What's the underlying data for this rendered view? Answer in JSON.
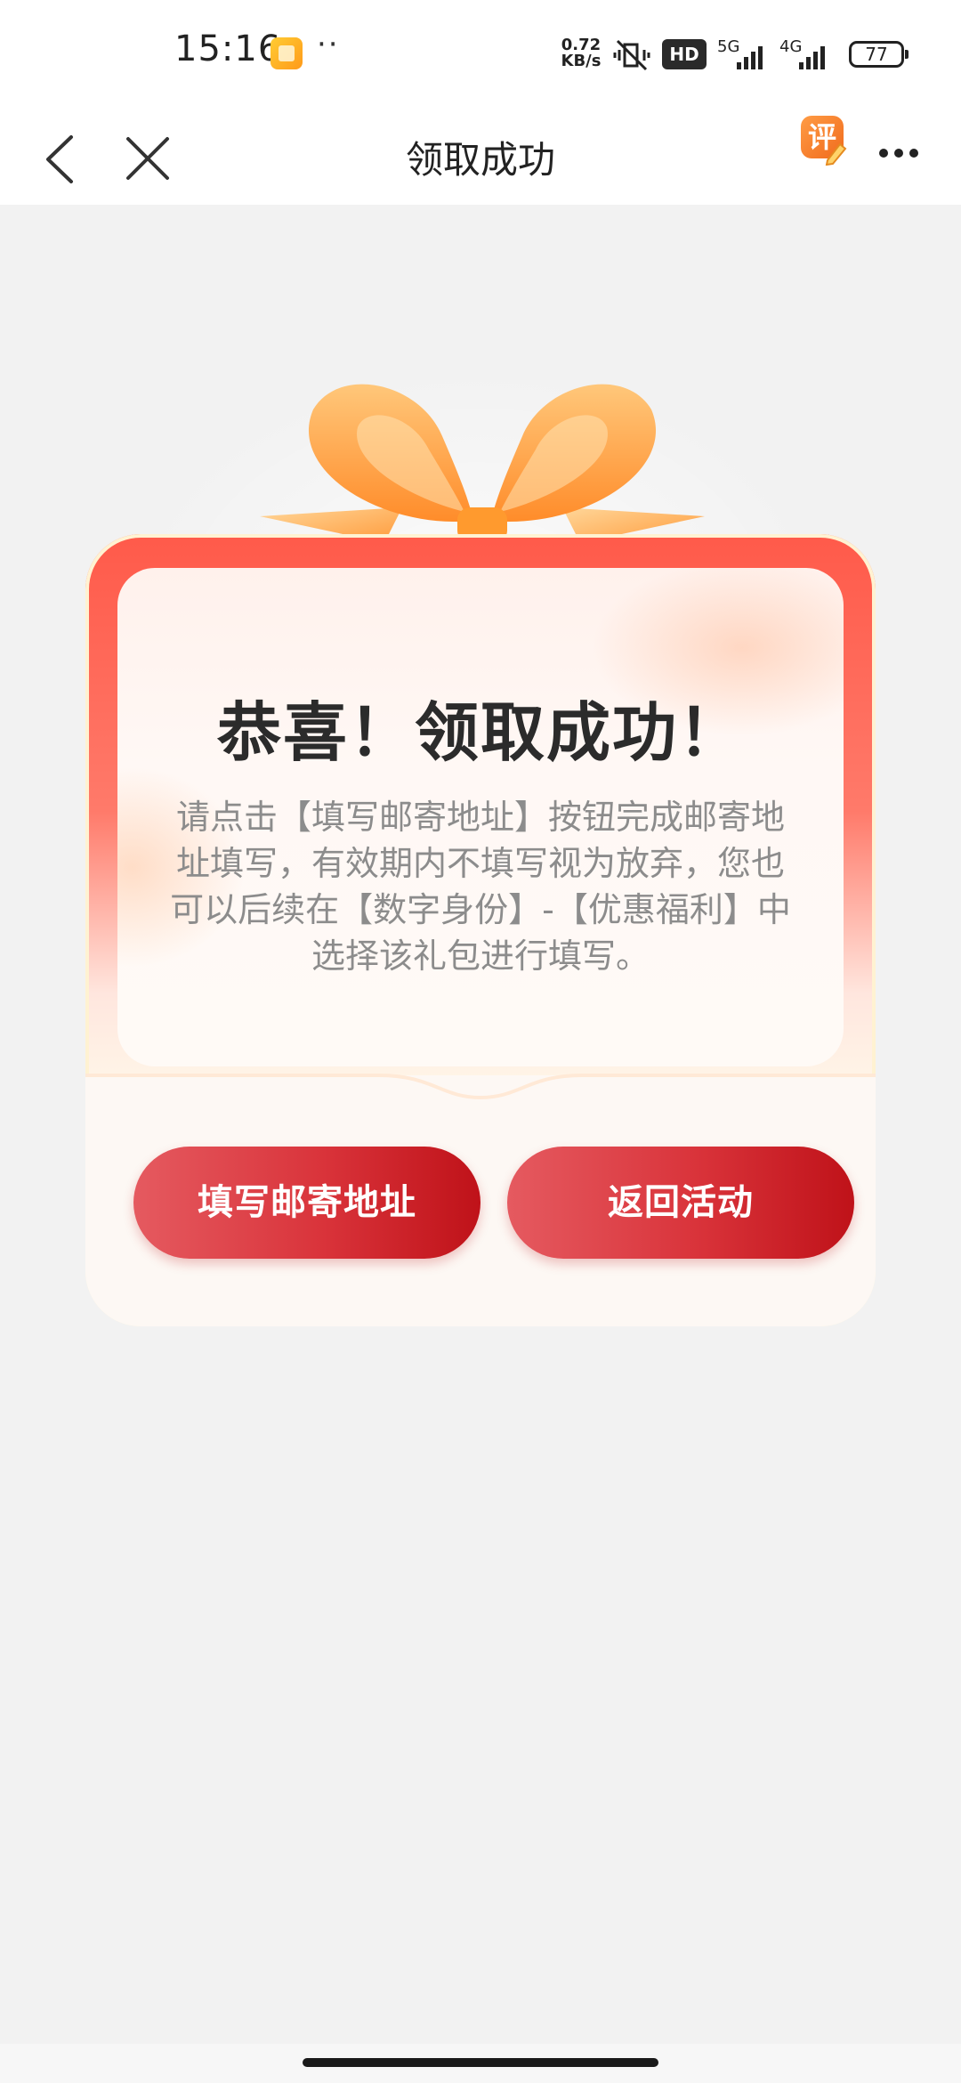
{
  "status_bar": {
    "time": "15:16",
    "dots": "··",
    "speed": "0.72\nKB/s",
    "speed_value": "0.72",
    "speed_unit": "KB/s",
    "hd_label": "HD",
    "net_5g": "5G",
    "net_4g": "4G",
    "battery": "77"
  },
  "nav": {
    "title": "领取成功",
    "rate_label": "评"
  },
  "card": {
    "headline": "恭喜！领取成功！",
    "description": "请点击【填写邮寄地址】按钮完成邮寄地址填写，有效期内不填写视为放弃，您也可以后续在【数字身份】-【优惠福利】中选择该礼包进行填写。",
    "buttons": {
      "fill_address": "填写邮寄地址",
      "return_activity": "返回活动"
    }
  },
  "colors": {
    "accent_red": "#d9333a",
    "bow_orange": "#ffa04a"
  }
}
